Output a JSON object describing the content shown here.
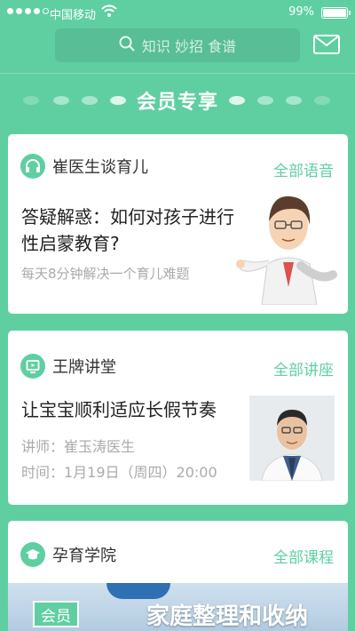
{
  "status_bar": {
    "carrier": "中国移动",
    "battery_percent": "99%",
    "battery_level": 0.99
  },
  "header": {
    "search_placeholder": "知识 妙招 食谱"
  },
  "member": {
    "title": "会员专享"
  },
  "cards": [
    {
      "title": "崔医生谈育儿",
      "more": "全部语音",
      "question": "答疑解惑：如何对孩子进行性启蒙教育?",
      "subtitle": "每天8分钟解决一个育儿难题"
    },
    {
      "title": "王牌讲堂",
      "more": "全部讲座",
      "lecture_title": "让宝宝顺利适应长假节奏",
      "teacher": "讲师：崔玉涛医生",
      "time": "时间：1月19日（周四）20:00"
    },
    {
      "title": "孕育学院",
      "more": "全部课程",
      "badge": "会员",
      "course_title": "家庭整理和收纳"
    }
  ],
  "colors": {
    "brand": "#5fcfa2",
    "card": "#ffffff"
  },
  "icons": {
    "search": "search-icon",
    "mail": "mail-icon",
    "headphones": "headphones-icon",
    "lecture": "video-board-icon",
    "academy": "graduation-cap-icon"
  }
}
